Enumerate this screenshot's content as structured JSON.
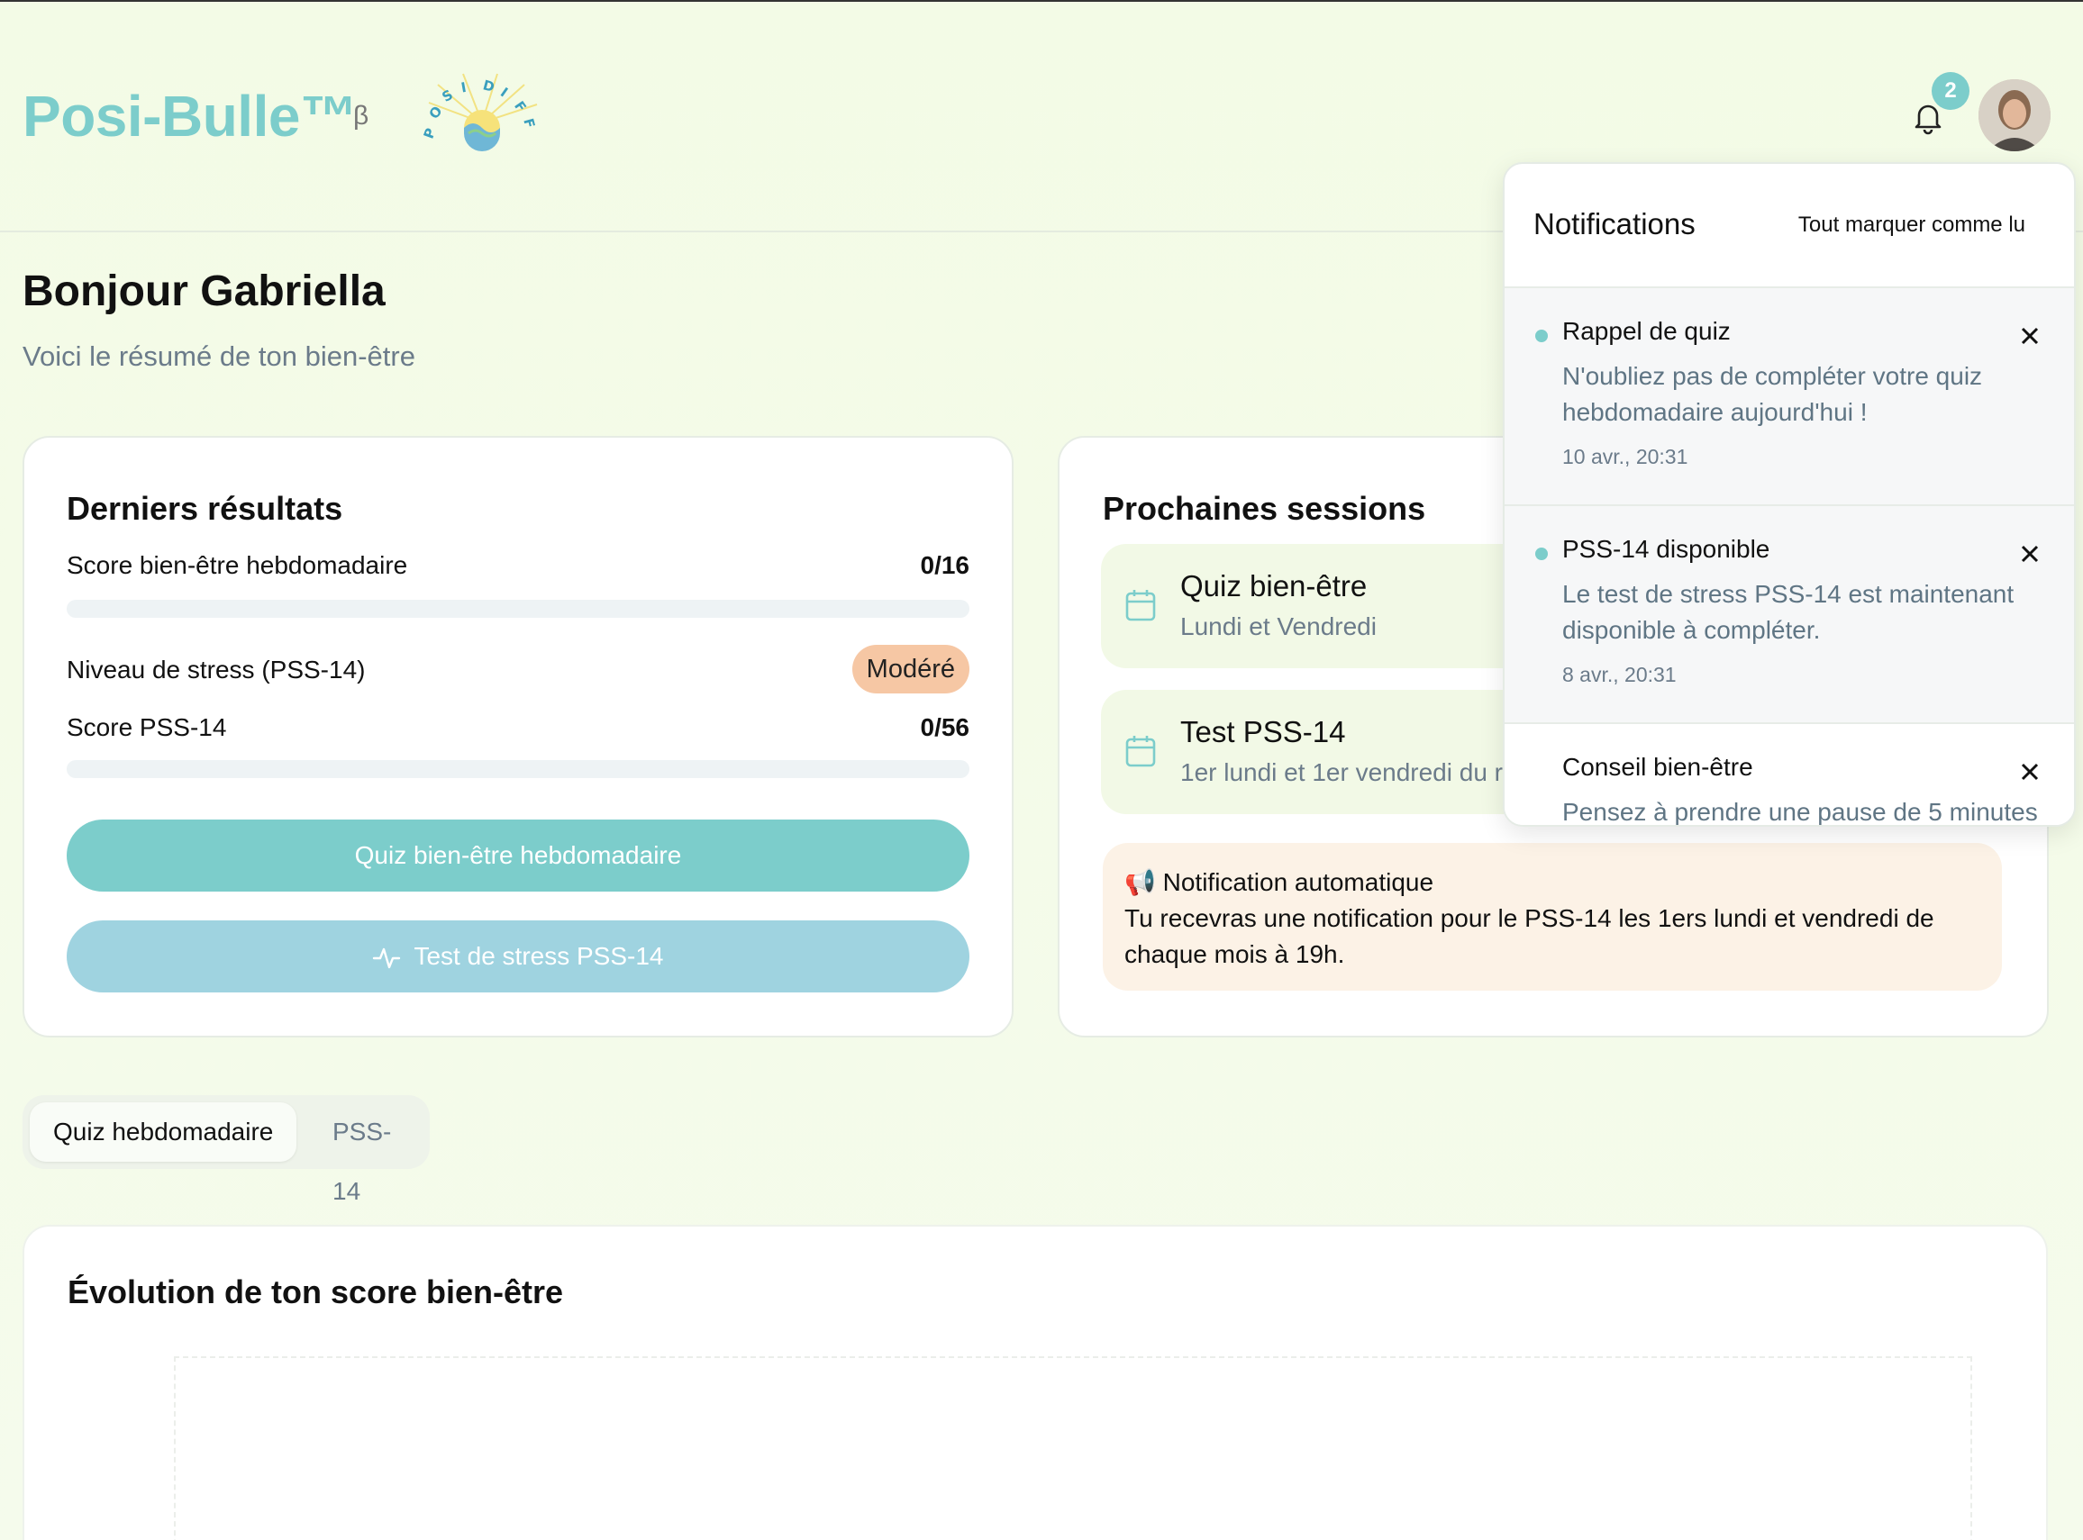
{
  "brand": {
    "name": "Posi-Bulle™",
    "beta": "β",
    "logo_text": "POSIDIFF"
  },
  "header": {
    "notification_count": "2"
  },
  "greeting": {
    "title": "Bonjour Gabriella",
    "subtitle": "Voici le résumé de ton bien-être"
  },
  "results": {
    "title": "Derniers résultats",
    "weekly_label": "Score bien-être hebdomadaire",
    "weekly_value": "0/16",
    "weekly_progress": 0,
    "stress_label": "Niveau de stress (PSS-14)",
    "stress_level": "Modéré",
    "pss_label": "Score PSS-14",
    "pss_value": "0/56",
    "pss_progress": 0,
    "quiz_button": "Quiz bien-être hebdomadaire",
    "stress_button": "Test de stress PSS-14"
  },
  "sessions": {
    "title": "Prochaines sessions",
    "items": [
      {
        "title": "Quiz bien-être",
        "subtitle": "Lundi et Vendredi"
      },
      {
        "title": "Test PSS-14",
        "subtitle": "1er lundi et 1er vendredi du r"
      }
    ],
    "auto_title": "📢 Notification automatique",
    "auto_body": "Tu recevras une notification pour le PSS-14 les 1ers lundi et vendredi de chaque mois à 19h."
  },
  "tabs": [
    {
      "label": "Quiz hebdomadaire",
      "active": true
    },
    {
      "label": "PSS-14",
      "active": false
    }
  ],
  "chart": {
    "title": "Évolution de ton score bien-être"
  },
  "notifications": {
    "title": "Notifications",
    "mark_all": "Tout marquer comme lu",
    "items": [
      {
        "title": "Rappel de quiz",
        "body": "N'oubliez pas de compléter votre quiz hebdomadaire aujourd'hui !",
        "time": "10 avr., 20:31",
        "unread": true
      },
      {
        "title": "PSS-14 disponible",
        "body": "Le test de stress PSS-14 est maintenant disponible à compléter.",
        "time": "8 avr., 20:31",
        "unread": true
      },
      {
        "title": "Conseil bien-être",
        "body": "Pensez à prendre une pause de 5 minutes",
        "time": "",
        "unread": false
      }
    ]
  },
  "colors": {
    "accent": "#7ccdcb",
    "accent_light": "#9fd3e0",
    "stress_badge": "#f6c7a4",
    "session_bg": "#f2f9e6",
    "auto_bg": "#fcf2e6"
  },
  "icons": [
    "bell-icon",
    "calendar-icon",
    "activity-icon",
    "close-icon"
  ]
}
